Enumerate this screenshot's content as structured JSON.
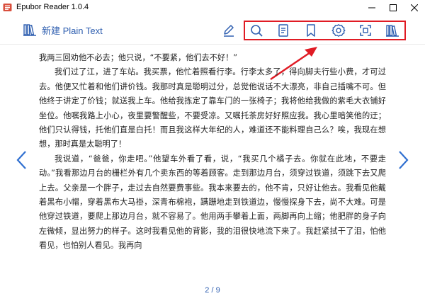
{
  "window": {
    "title": "Epubor Reader 1.0.4",
    "buttons": [
      "minimize",
      "maximize",
      "close"
    ]
  },
  "toolbar": {
    "library_label": "新建 Plain Text",
    "icons": [
      "pen-icon",
      "search-icon",
      "toc-icon",
      "bookmark-icon",
      "settings-icon",
      "fullscreen-icon",
      "library-icon"
    ]
  },
  "colors": {
    "accent": "#2f5fb0",
    "highlight": "#e01b24",
    "text": "#222222"
  },
  "book": {
    "paragraphs": [
      {
        "indent": false,
        "text": "我两三回劝他不必去；他只说，“不要紧，他们去不好！”"
      },
      {
        "indent": true,
        "text": "我们过了江，进了车站。我买票，他忙着照看行李。行李太多了，得向脚夫行些小费，才可过去。他便又忙着和他们讲价钱。我那时真是聪明过分，总觉他说话不大漂亮，非自己插嘴不可。但他终于讲定了价钱；就送我上车。他给我拣定了靠车门的一张椅子；我将他给我做的紫毛大衣铺好坐位。他嘱我路上小心，夜里要警醒些，不要受凉。又嘱托茶房好好照应我。我心里暗笑他的迂；他们只认得钱，托他们直是白托！而且我这样大年纪的人，难道还不能料理自己么？唉，我现在想想，那时真是太聪明了！"
      },
      {
        "indent": true,
        "text": "我说道，“爸爸，你走吧。”他望车外看了看，说，“我买几个橘子去。你就在此地，不要走动。”我看那边月台的栅栏外有几个卖东西的等着顾客。走到那边月台，须穿过铁道，须跳下去又爬上去。父亲是一个胖子，走过去自然要费事些。我本来要去的，他不肯，只好让他去。我看见他戴着黑布小帽，穿着黑布大马褂，深青布棉袍，蹒跚地走到铁道边，慢慢探身下去，尚不大难。可是他穿过铁道，要爬上那边月台，就不容易了。他用两手攀着上面，两脚再向上缩；他肥胖的身子向左微倾，显出努力的样子。这时我看见他的背影，我的泪很快地流下来了。我赶紧拭干了泪，怕他看见，也怕别人看见。我再向"
      }
    ],
    "page": "2 / 9"
  }
}
